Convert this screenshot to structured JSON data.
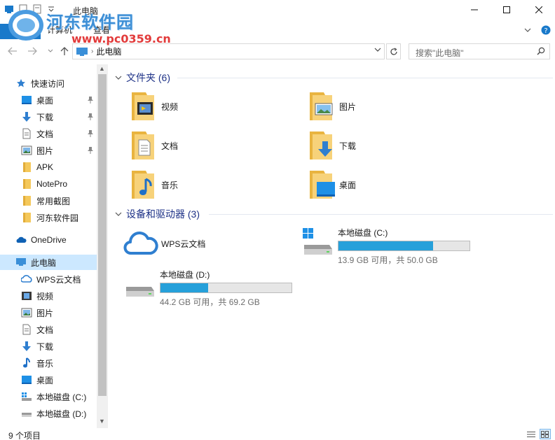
{
  "watermark": {
    "main": "河东软件园",
    "sub": "www.pc0359.cn"
  },
  "window": {
    "title": "此电脑"
  },
  "ribbon": {
    "file": "文件",
    "tabs": [
      "计算机",
      "查看"
    ]
  },
  "address": {
    "location": "此电脑"
  },
  "search": {
    "placeholder": "搜索\"此电脑\""
  },
  "nav": {
    "quick_access": "快速访问",
    "quick_items": [
      {
        "label": "桌面",
        "icon": "desktop-icon",
        "pinned": true
      },
      {
        "label": "下载",
        "icon": "download-icon",
        "pinned": true
      },
      {
        "label": "文档",
        "icon": "document-icon",
        "pinned": true
      },
      {
        "label": "图片",
        "icon": "picture-icon",
        "pinned": true
      },
      {
        "label": "APK",
        "icon": "folder-icon",
        "pinned": false
      },
      {
        "label": "NotePro",
        "icon": "folder-icon",
        "pinned": false
      },
      {
        "label": "常用截图",
        "icon": "folder-icon",
        "pinned": false
      },
      {
        "label": "河东软件园",
        "icon": "folder-icon",
        "pinned": false
      }
    ],
    "onedrive": "OneDrive",
    "this_pc": "此电脑",
    "pc_items": [
      {
        "label": "WPS云文档",
        "icon": "cloud-icon"
      },
      {
        "label": "视频",
        "icon": "video-icon"
      },
      {
        "label": "图片",
        "icon": "picture-icon"
      },
      {
        "label": "文档",
        "icon": "document-icon"
      },
      {
        "label": "下载",
        "icon": "download-icon"
      },
      {
        "label": "音乐",
        "icon": "music-icon"
      },
      {
        "label": "桌面",
        "icon": "desktop-icon"
      },
      {
        "label": "本地磁盘 (C:)",
        "icon": "drive-c-icon"
      },
      {
        "label": "本地磁盘 (D:)",
        "icon": "drive-icon"
      }
    ]
  },
  "content": {
    "folders_header": "文件夹 (6)",
    "folders": [
      {
        "label": "视频",
        "icon": "video-folder-icon"
      },
      {
        "label": "图片",
        "icon": "picture-folder-icon"
      },
      {
        "label": "文档",
        "icon": "document-folder-icon"
      },
      {
        "label": "下载",
        "icon": "download-folder-icon"
      },
      {
        "label": "音乐",
        "icon": "music-folder-icon"
      },
      {
        "label": "桌面",
        "icon": "desktop-folder-icon"
      }
    ],
    "devices_header": "设备和驱动器 (3)",
    "wps": {
      "label": "WPS云文档"
    },
    "drives": [
      {
        "name": "本地磁盘 (C:)",
        "free": "13.9 GB 可用，共 50.0 GB",
        "used_fraction": 0.722
      },
      {
        "name": "本地磁盘 (D:)",
        "free": "44.2 GB 可用，共 69.2 GB",
        "used_fraction": 0.361
      }
    ]
  },
  "status": {
    "count": "9 个项目"
  },
  "colors": {
    "accent": "#1979ca",
    "selection": "#cce8ff",
    "bar_fill": "#26a0da",
    "header_text": "#1e3287",
    "folder": "#f4c85b"
  }
}
